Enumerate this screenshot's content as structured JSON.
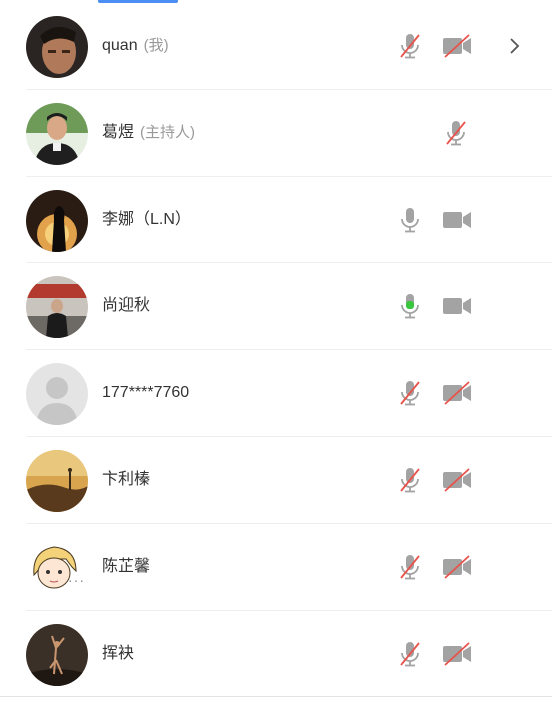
{
  "participants": [
    {
      "name": "quan",
      "role": "(我)",
      "mic": "muted",
      "cam": "off",
      "has_chevron": true
    },
    {
      "name": "葛煜",
      "role": "(主持人)",
      "mic": "muted",
      "cam": "none"
    },
    {
      "name": "李娜（L.N）",
      "role": "",
      "mic": "on",
      "cam": "on"
    },
    {
      "name": "尚迎秋",
      "role": "",
      "mic": "speaking",
      "cam": "on"
    },
    {
      "name": "177****7760",
      "role": "",
      "mic": "muted",
      "cam": "off"
    },
    {
      "name": "卞利榛",
      "role": "",
      "mic": "muted",
      "cam": "off"
    },
    {
      "name": "陈芷馨",
      "role": "",
      "mic": "muted",
      "cam": "off",
      "dots": "···"
    },
    {
      "name": "挥袂",
      "role": "",
      "mic": "muted",
      "cam": "off"
    }
  ],
  "colors": {
    "icon_gray": "#a3a3a3",
    "mute_red": "#e8524a",
    "speaking_green": "#3cc640",
    "accent_blue": "#4d8ef5"
  }
}
